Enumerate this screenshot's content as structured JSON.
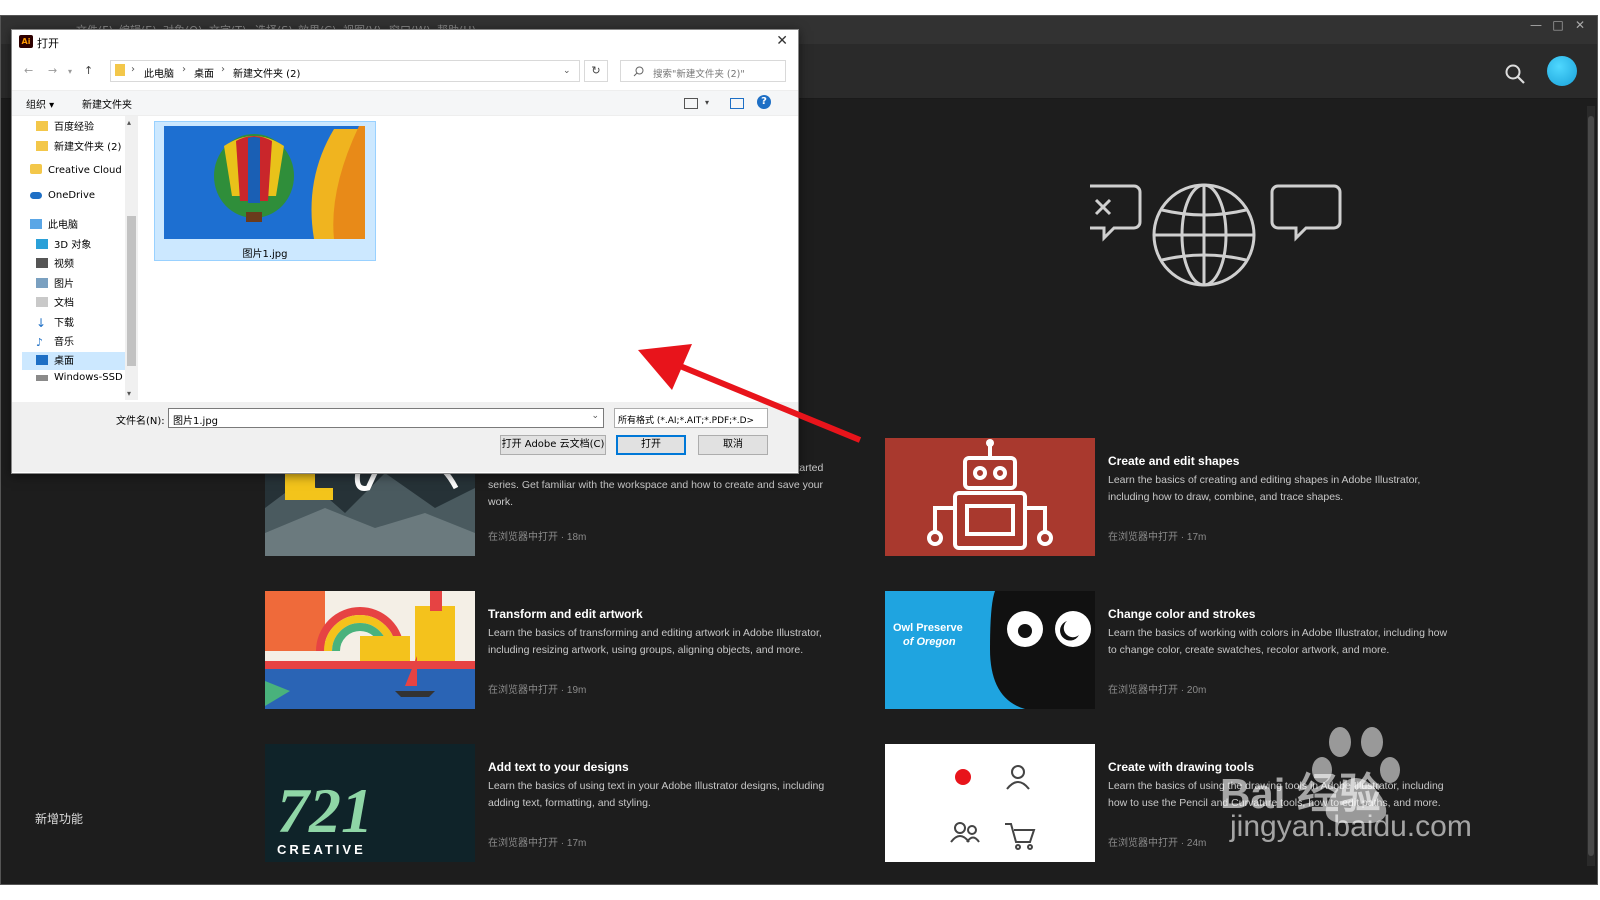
{
  "app": {
    "menu": [
      "文件(F)",
      "编辑(E)",
      "对象(O)",
      "文字(T)",
      "选择(S)",
      "效果(C)",
      "视图(V)",
      "窗口(W)",
      "帮助(H)"
    ],
    "whats_new": "新增功能"
  },
  "dialog": {
    "title": "打开",
    "breadcrumb": [
      "此电脑",
      "桌面",
      "新建文件夹 (2)"
    ],
    "search_placeholder": "搜索\"新建文件夹 (2)\"",
    "toolbar": {
      "organize": "组织 ▾",
      "new_folder": "新建文件夹"
    },
    "nav_items": [
      {
        "label": "百度经验",
        "icon": "folder-icon"
      },
      {
        "label": "新建文件夹 (2)",
        "icon": "folder-icon"
      },
      {
        "label": "Creative Cloud F",
        "icon": "creative-cloud-folder-icon"
      },
      {
        "label": "OneDrive",
        "icon": "cloud-icon"
      },
      {
        "label": "此电脑",
        "icon": "computer-icon"
      },
      {
        "label": "3D 对象",
        "icon": "cube-icon"
      },
      {
        "label": "视频",
        "icon": "video-icon"
      },
      {
        "label": "图片",
        "icon": "picture-icon"
      },
      {
        "label": "文档",
        "icon": "document-icon"
      },
      {
        "label": "下载",
        "icon": "download-icon"
      },
      {
        "label": "音乐",
        "icon": "music-icon"
      },
      {
        "label": "桌面",
        "icon": "desktop-icon"
      },
      {
        "label": "Windows-SSD",
        "icon": "drive-icon"
      }
    ],
    "file": {
      "name": "图片1.jpg"
    },
    "filename_label": "文件名(N):",
    "filename_value": "图片1.jpg",
    "filetype_value": "所有格式 (*.AI;*.AIT;*.PDF;*.D>",
    "buttons": {
      "cloud": "打开 Adobe 云文档(C)",
      "open": "打开",
      "cancel": "取消"
    }
  },
  "cards": [
    {
      "title": "",
      "desc": "Learn Adobe Illustrator's basic tools and techniques with the Get Started series. Get familiar with the workspace and how to create and save your work.",
      "meta": "在浏览器中打开 · 18m"
    },
    {
      "title": "Create and edit shapes",
      "desc": "Learn the basics of creating and editing shapes in Adobe Illustrator, including how to draw, combine, and trace shapes.",
      "meta": "在浏览器中打开 · 17m"
    },
    {
      "title": "Transform and edit artwork",
      "desc": "Learn the basics of transforming and editing artwork in Adobe Illustrator, including resizing artwork, using groups, aligning objects, and more.",
      "meta": "在浏览器中打开 · 19m"
    },
    {
      "title": "Change color and strokes",
      "desc": "Learn the basics of working with colors in Adobe Illustrator, including how to change color, create swatches, recolor artwork, and more.",
      "meta": "在浏览器中打开 · 20m"
    },
    {
      "title": "Add text to your designs",
      "desc": "Learn the basics of using text in your Adobe Illustrator designs, including adding text, formatting, and styling.",
      "meta": "在浏览器中打开 · 17m"
    },
    {
      "title": "Create with drawing tools",
      "desc": "Learn the basics of using the drawing tools in Adobe Illustrator, including how to use the Pencil and Curvature tools, how to edit paths, and more.",
      "meta": "在浏览器中打开 · 24m"
    }
  ],
  "thumb_text": {
    "owl_line1": "Owl Preserve",
    "owl_line2": "of Oregon",
    "num": "721",
    "creative": "CREATIVE"
  },
  "watermark": {
    "cn": "Bai 经验",
    "url": "jingyan.baidu.com"
  },
  "colors": {
    "arrow": "#e8141b",
    "accent": "#0078d7",
    "selection": "#cce8ff"
  }
}
